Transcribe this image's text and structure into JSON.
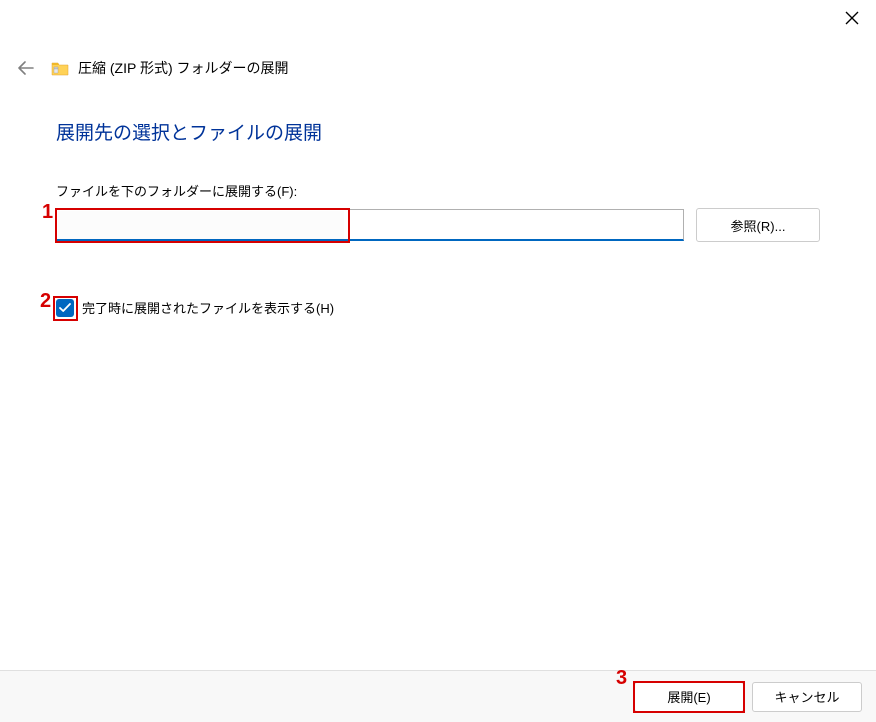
{
  "titlebar": {
    "close_icon": "close"
  },
  "header": {
    "back_icon": "back-arrow",
    "folder_icon": "zip-folder",
    "wizard_title": "圧縮 (ZIP 形式) フォルダーの展開"
  },
  "content": {
    "heading": "展開先の選択とファイルの展開",
    "field_label": "ファイルを下のフォルダーに展開する(F):",
    "path_value": "",
    "browse_button_label": "参照(R)...",
    "checkbox_checked": true,
    "checkbox_label": "完了時に展開されたファイルを表示する(H)"
  },
  "footer": {
    "extract_button_label": "展開(E)",
    "cancel_button_label": "キャンセル"
  },
  "annotations": {
    "n1": "1",
    "n2": "2",
    "n3": "3",
    "color": "#d60000"
  }
}
